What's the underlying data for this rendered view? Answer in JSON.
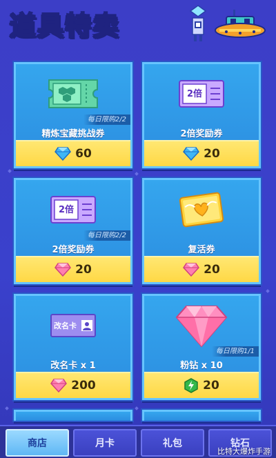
{
  "header": {
    "title": "道具特卖"
  },
  "items": [
    {
      "name": "精炼宝藏挑战券",
      "limit": "每日限购2/2",
      "price": "60",
      "currency": "diamond-blue",
      "icon": "green-ticket"
    },
    {
      "name": "2倍奖励券",
      "limit": "",
      "price": "20",
      "currency": "diamond-blue",
      "icon": "double-ticket",
      "icon_text": "2倍"
    },
    {
      "name": "2倍奖励券",
      "limit": "每日限购2/2",
      "price": "20",
      "currency": "diamond-pink",
      "icon": "double-ticket",
      "icon_text": "2倍"
    },
    {
      "name": "复活券",
      "limit": "",
      "price": "20",
      "currency": "diamond-pink",
      "icon": "revive-ticket"
    },
    {
      "name": "改名卡 x 1",
      "limit": "",
      "price": "200",
      "currency": "diamond-pink",
      "icon": "rename-card",
      "icon_text": "改名卡"
    },
    {
      "name": "粉钻 x 10",
      "limit": "每日限购1/1",
      "price": "20",
      "currency": "energy-green",
      "icon": "pink-diamond"
    }
  ],
  "tabs": [
    {
      "label": "商店",
      "active": true
    },
    {
      "label": "月卡",
      "active": false
    },
    {
      "label": "礼包",
      "active": false
    },
    {
      "label": "钻石",
      "active": false
    }
  ],
  "watermark": "比特大爆炸手游"
}
